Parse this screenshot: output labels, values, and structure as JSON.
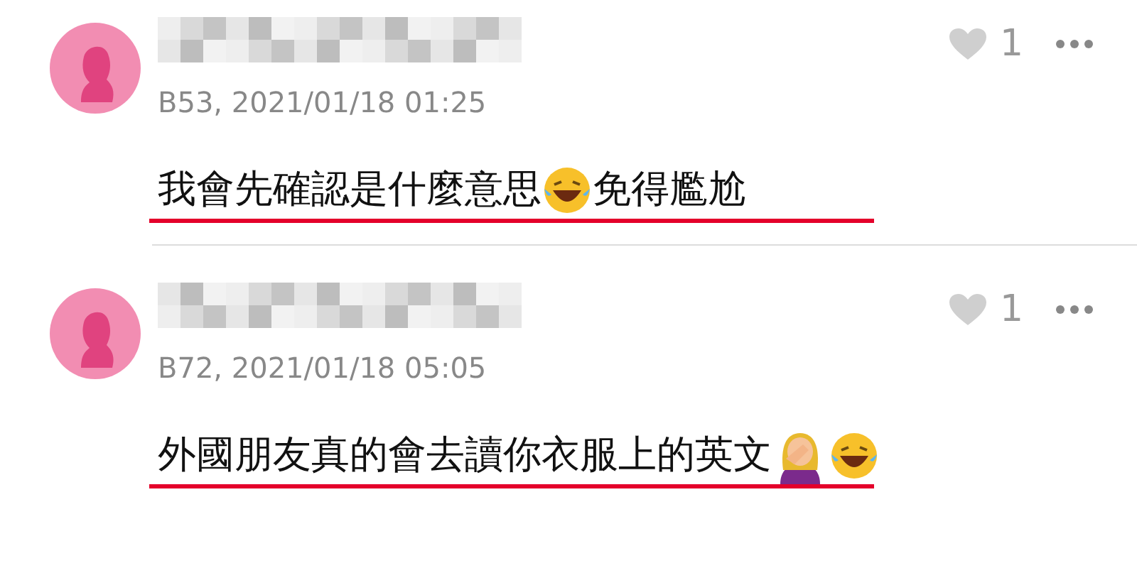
{
  "comments": [
    {
      "meta": "B53, 2021/01/18 01:25",
      "likes": "1",
      "liked": false,
      "parts": [
        {
          "kind": "text",
          "text": "我會先確認是什麼意思"
        },
        {
          "kind": "laugh"
        },
        {
          "kind": "text",
          "text": "免得尷尬"
        }
      ]
    },
    {
      "meta": "B72, 2021/01/18 05:05",
      "likes": "1",
      "liked": false,
      "parts": [
        {
          "kind": "text",
          "text": "外國朋友真的會去讀你衣服上的英文"
        },
        {
          "kind": "facepalm"
        },
        {
          "kind": "laugh"
        }
      ]
    }
  ]
}
